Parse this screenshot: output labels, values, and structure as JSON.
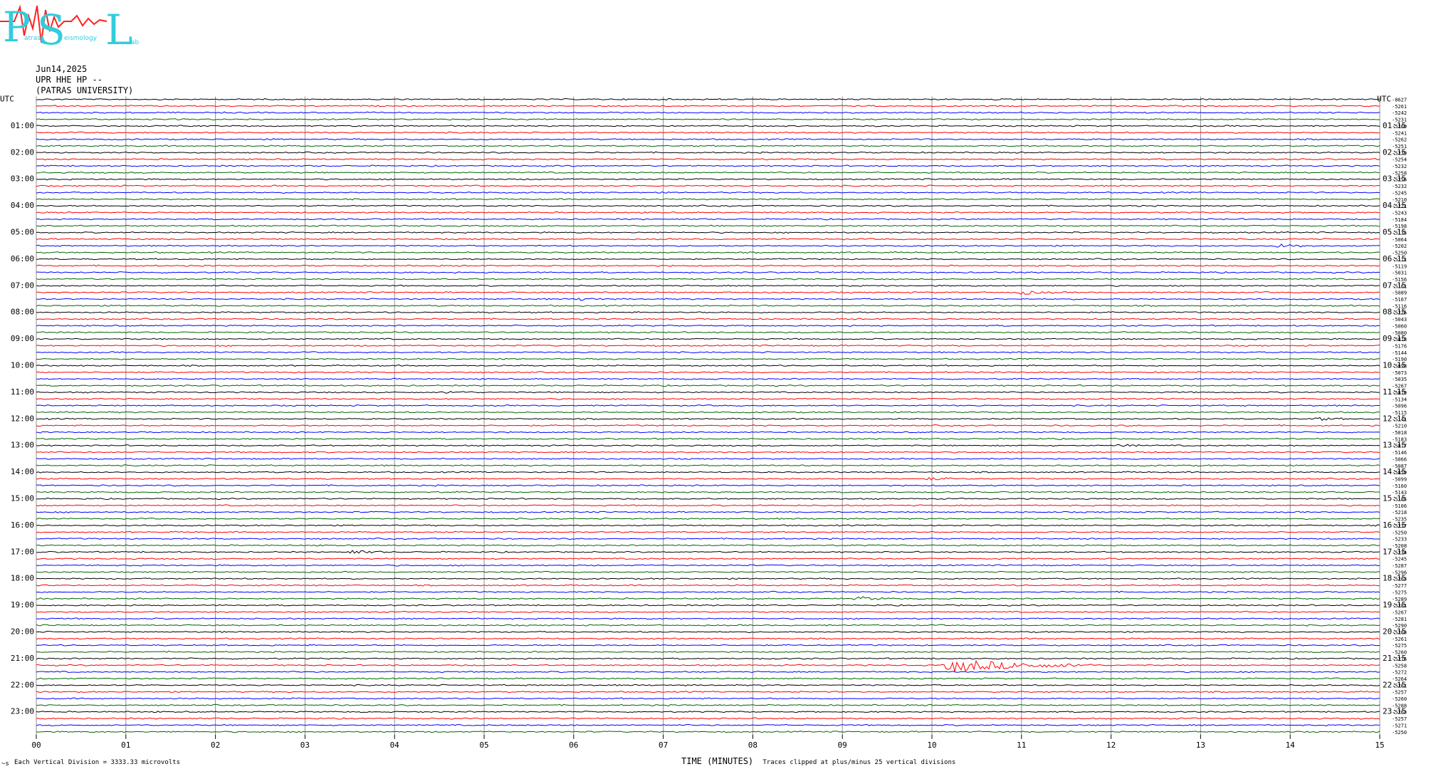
{
  "logo": {
    "letters": [
      "P",
      "S",
      "L"
    ],
    "small_words": [
      "atras",
      "eismology",
      "ab"
    ],
    "colors": {
      "letters": "#33ccdd",
      "wave": "#ff2222"
    }
  },
  "header": {
    "date": "Jun14,2025",
    "station": "UPR HHE HP --",
    "institution": "(PATRAS UNIVERSITY)"
  },
  "axis_left_title": "UTC",
  "axis_right_title": "UTC",
  "left_hour_labels": [
    "01:00",
    "02:00",
    "03:00",
    "04:00",
    "05:00",
    "06:00",
    "07:00",
    "08:00",
    "09:00",
    "10:00",
    "11:00",
    "12:00",
    "13:00",
    "14:00",
    "15:00",
    "16:00",
    "17:00",
    "18:00",
    "19:00",
    "20:00",
    "21:00",
    "22:00",
    "23:00"
  ],
  "right_hour_labels": [
    "01:15",
    "02:15",
    "03:15",
    "04:15",
    "05:15",
    "06:15",
    "07:15",
    "08:15",
    "09:15",
    "10:15",
    "11:15",
    "12:15",
    "13:15",
    "14:15",
    "15:15",
    "16:15",
    "17:15",
    "18:15",
    "19:15",
    "20:15",
    "21:15",
    "22:15",
    "23:15"
  ],
  "trace_offsets": [
    "-8627",
    "-5261",
    "-5242",
    "-5231",
    "-5260",
    "-5241",
    "-5262",
    "-5251",
    "-5239",
    "-5254",
    "-5232",
    "-5258",
    "-5256",
    "-5232",
    "-5245",
    "-5210",
    "-5221",
    "-5243",
    "-5184",
    "-5198",
    "-5135",
    "-5064",
    "-5202",
    "-5250",
    "-5111",
    "-5119",
    "-5031",
    "-5156",
    "-5161",
    "-5089",
    "-5167",
    "-5116",
    "-5226",
    "-5043",
    "-5060",
    "-5080",
    "-5018",
    "-5176",
    "-5144",
    "-5190",
    "-5098",
    "-5073",
    "-5035",
    "-5267",
    "-5079",
    "-5134",
    "-5096",
    "-5115",
    "-5141",
    "-5210",
    "-5018",
    "-5183",
    "-5077",
    "-5146",
    "-5066",
    "-5087",
    "-5059",
    "-5099",
    "-5160",
    "-5143",
    "-5185",
    "-5106",
    "-5218",
    "-5235",
    "-5237",
    "-5250",
    "-5233",
    "-5208",
    "-5234",
    "-5245",
    "-5287",
    "-5296",
    "-5263",
    "-5277",
    "-5275",
    "-5289",
    "-5281",
    "-5267",
    "-5281",
    "-5290",
    "-5268",
    "-5261",
    "-5275",
    "-5260",
    "-5276",
    "-5258",
    "-5272",
    "-5264",
    "-5261",
    "-5257",
    "-5260",
    "-5288",
    "-5263",
    "-5257",
    "-5271",
    "-5250"
  ],
  "x_tick_labels": [
    "00",
    "01",
    "02",
    "03",
    "04",
    "05",
    "06",
    "07",
    "08",
    "09",
    "10",
    "11",
    "12",
    "13",
    "14",
    "15"
  ],
  "footer": {
    "left_symbol": "~s",
    "scale_note": "Each Vertical Division = 3333.33 microvolts",
    "xlabel": "TIME (MINUTES)",
    "clip_note": "Traces clipped at plus/minus 25 vertical divisions"
  },
  "chart_data": {
    "type": "line",
    "xlabel": "TIME (MINUTES)",
    "xlim": [
      0,
      15
    ],
    "x_ticks": [
      "00",
      "01",
      "02",
      "03",
      "04",
      "05",
      "06",
      "07",
      "08",
      "09",
      "10",
      "11",
      "12",
      "13",
      "14",
      "15"
    ],
    "minutes_per_trace": 15,
    "trace_count": 96,
    "trace_colors": [
      "#000000",
      "#ff0000",
      "#0000ff",
      "#006400"
    ],
    "grid": true,
    "events": [
      {
        "trace_index": 85,
        "minute": 10.2,
        "peak_amplitude_divisions": 2.0,
        "duration_minutes": 1.6
      },
      {
        "trace_index": 68,
        "minute": 3.5,
        "peak_amplitude_divisions": 0.6,
        "duration_minutes": 0.4
      },
      {
        "trace_index": 29,
        "minute": 11.0,
        "peak_amplitude_divisions": 0.6,
        "duration_minutes": 0.4
      },
      {
        "trace_index": 22,
        "minute": 13.9,
        "peak_amplitude_divisions": 0.6,
        "duration_minutes": 0.4
      },
      {
        "trace_index": 30,
        "minute": 6.1,
        "peak_amplitude_divisions": 0.5,
        "duration_minutes": 0.3
      },
      {
        "trace_index": 75,
        "minute": 9.2,
        "peak_amplitude_divisions": 0.5,
        "duration_minutes": 0.4
      },
      {
        "trace_index": 48,
        "minute": 14.3,
        "peak_amplitude_divisions": 0.4,
        "duration_minutes": 0.4
      },
      {
        "trace_index": 52,
        "minute": 12.1,
        "peak_amplitude_divisions": 0.4,
        "duration_minutes": 0.3
      },
      {
        "trace_index": 44,
        "minute": 4.6,
        "peak_amplitude_divisions": 0.4,
        "duration_minutes": 0.3
      },
      {
        "trace_index": 57,
        "minute": 10.0,
        "peak_amplitude_divisions": 0.4,
        "duration_minutes": 0.3
      }
    ]
  }
}
